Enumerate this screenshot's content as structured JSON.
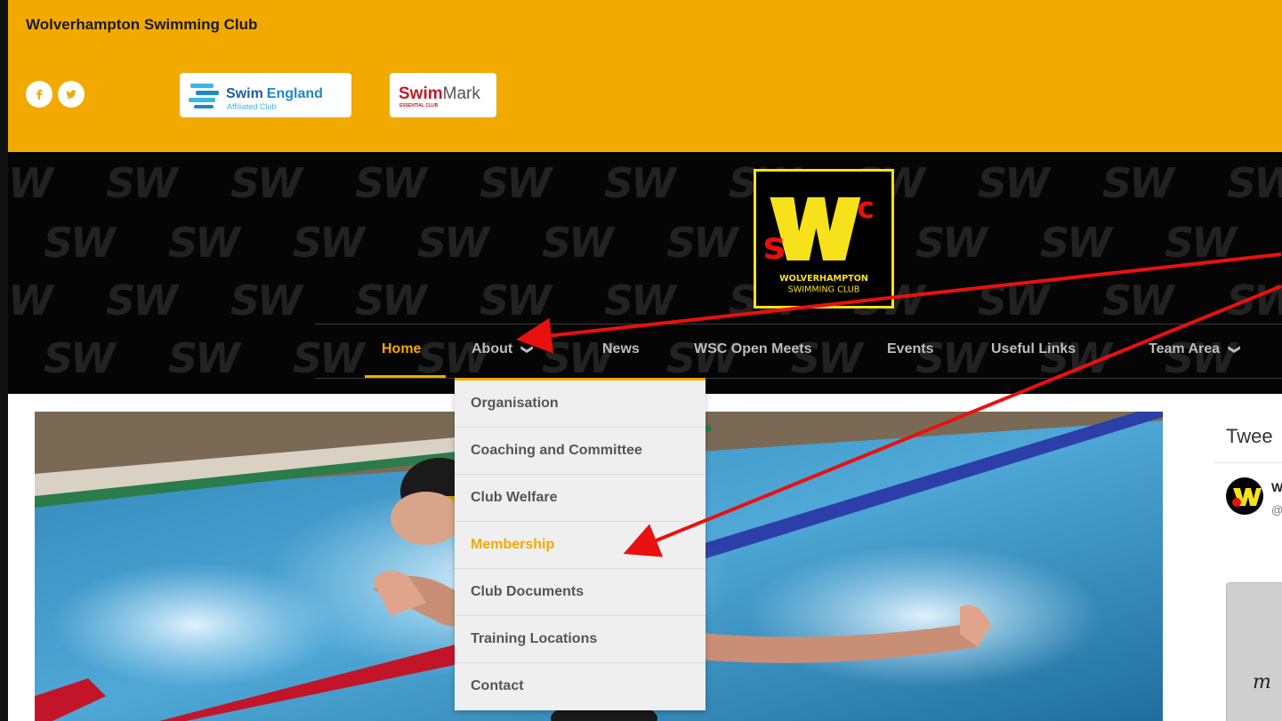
{
  "site": {
    "name": "Wolverhampton Swimming Club"
  },
  "social": [
    {
      "icon": "facebook-icon"
    },
    {
      "icon": "twitter-icon"
    }
  ],
  "badges": {
    "swim_england": {
      "brand": "Swim England",
      "brand_part1": "Swim",
      "brand_part2": "England",
      "sub": "Affiliated Club"
    },
    "swimmark": {
      "brand_part1": "Swim",
      "brand_part2": "Mark",
      "sub": "ESSENTIAL CLUB"
    }
  },
  "logo": {
    "line1": "WOLVERHAMPTON",
    "line2": "SWIMMING CLUB",
    "mark_letters": [
      "s",
      "W",
      "c"
    ]
  },
  "nav": {
    "items": [
      {
        "label": "Home",
        "active": true
      },
      {
        "label": "About",
        "dropdown": true
      },
      {
        "label": "News"
      },
      {
        "label": "WSC Open Meets"
      },
      {
        "label": "Events"
      },
      {
        "label": "Useful Links"
      },
      {
        "label": "Team Area",
        "dropdown": true
      }
    ]
  },
  "dropdown": {
    "items": [
      {
        "label": "Organisation"
      },
      {
        "label": "Coaching and Committee"
      },
      {
        "label": "Club Welfare"
      },
      {
        "label": "Membership",
        "highlight": true
      },
      {
        "label": "Club Documents"
      },
      {
        "label": "Training Locations"
      },
      {
        "label": "Contact"
      }
    ]
  },
  "tweets": {
    "title": "Twee",
    "name": "W",
    "handle": "@",
    "script_text": "m"
  },
  "colors": {
    "accent": "#f2a900",
    "hero_bg": "#050505",
    "logo_yellow": "#f7e11a",
    "logo_red": "#e3120b",
    "annotation_red": "#e8110f"
  }
}
